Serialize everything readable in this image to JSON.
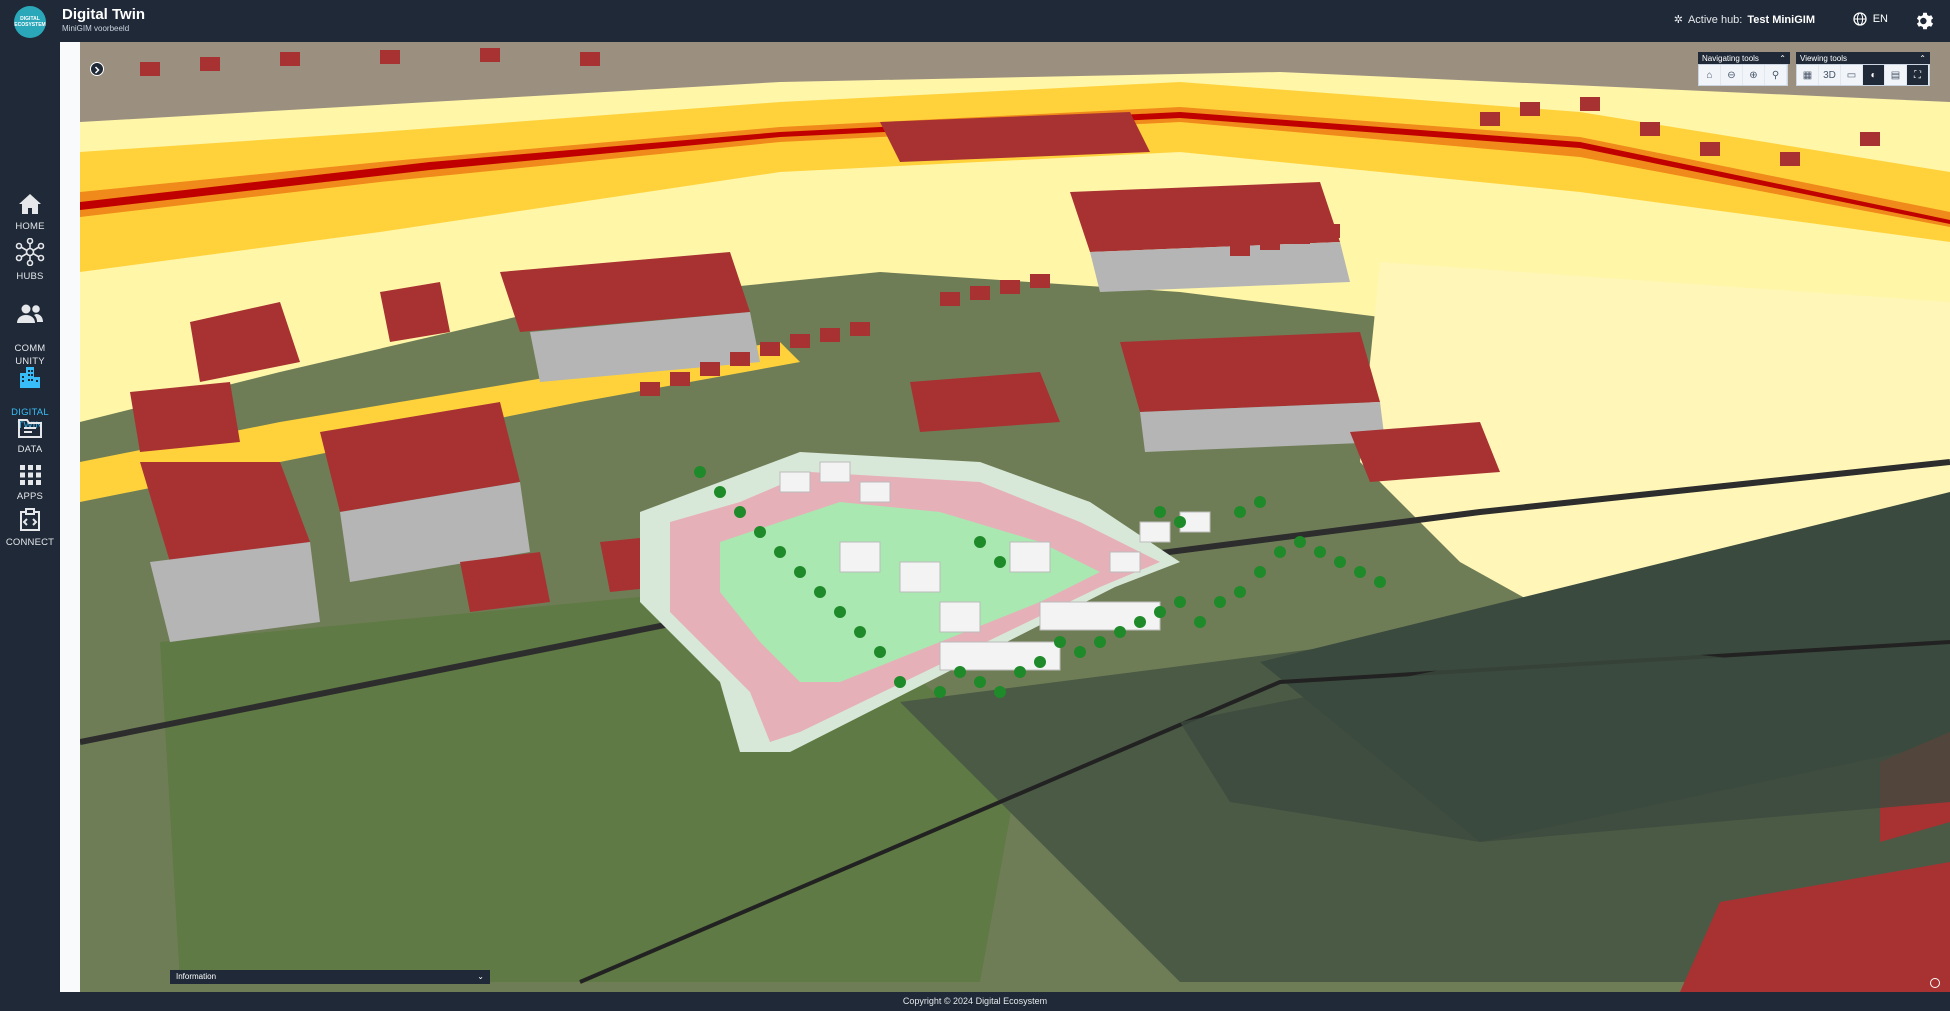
{
  "header": {
    "logo_text": "DIGITAL ECOSYSTEM",
    "title": "Digital Twin",
    "subtitle": "MiniGIM voorbeeld",
    "active_hub_label": "Active hub:",
    "active_hub_name": "Test MiniGIM",
    "language": "EN"
  },
  "sidebar": {
    "items": [
      {
        "label": "HOME",
        "icon": "home-icon"
      },
      {
        "label": "HUBS",
        "icon": "hubs-icon"
      },
      {
        "label": "COMM\nUNITY",
        "icon": "community-icon"
      },
      {
        "label": "DIGITAL\nTWIN",
        "icon": "building-icon"
      },
      {
        "label": "DATA",
        "icon": "folder-icon"
      },
      {
        "label": "APPS",
        "icon": "grid-icon"
      },
      {
        "label": "CONNECT",
        "icon": "connect-icon"
      }
    ]
  },
  "map": {
    "navigating_tools_label": "Navigating tools",
    "viewing_tools_label": "Viewing tools",
    "nav_tools": [
      "home",
      "zoom-out",
      "zoom-in",
      "search"
    ],
    "view_tools": [
      "map",
      "3D",
      "measure",
      "contrast",
      "calculator",
      "fullscreen"
    ],
    "view_3d_label": "3D",
    "info_panel_label": "Information"
  },
  "footer": {
    "copyright": "Copyright © 2024 Digital Ecosystem"
  },
  "colors": {
    "background": "#1f2937",
    "accent": "#38bdf8",
    "noise_red": "#c00000",
    "noise_yellow": "#ffe14d",
    "building_roof": "#a83232"
  }
}
